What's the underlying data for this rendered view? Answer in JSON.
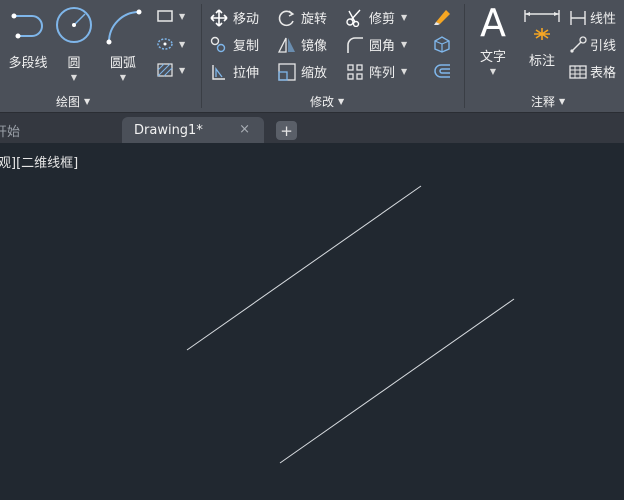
{
  "ribbon": {
    "draw_panel": {
      "title": "绘图",
      "polyline": "多段线",
      "circle": "圆",
      "arc": "圆弧"
    },
    "modify_panel": {
      "title": "修改",
      "move": "移动",
      "rotate": "旋转",
      "trim": "修剪",
      "copy": "复制",
      "mirror": "镜像",
      "fillet": "圆角",
      "stretch": "拉伸",
      "scale": "缩放",
      "array": "阵列"
    },
    "annotation_panel": {
      "title": "注释",
      "text": "文字",
      "dimension": "标注",
      "linear": "线性",
      "leader": "引线",
      "table": "表格"
    }
  },
  "tabs": {
    "start": "开始",
    "drawing": "Drawing1*",
    "close": "×",
    "new": "+"
  },
  "viewport": {
    "label": "观][二维线框]",
    "background": "#212830",
    "line_color": "#d8dce0"
  },
  "colors": {
    "ribbon_bg": "#4b5059",
    "tabbar_bg": "#343840",
    "accent_blue": "#7fb6ea"
  }
}
